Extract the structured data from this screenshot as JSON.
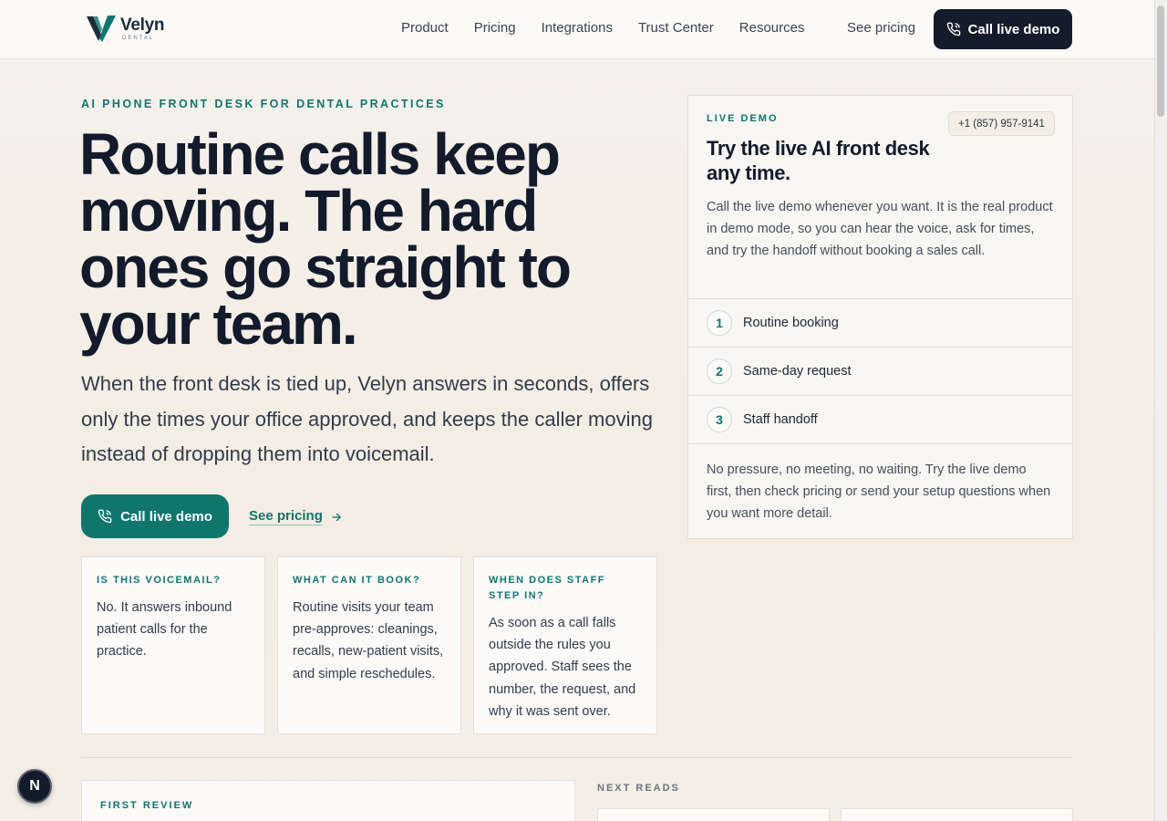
{
  "brand": {
    "name": "Velyn",
    "sub": "DENTAL"
  },
  "nav": {
    "items": [
      "Product",
      "Pricing",
      "Integrations",
      "Trust Center",
      "Resources"
    ],
    "see_pricing": "See pricing",
    "cta": "Call live demo"
  },
  "hero": {
    "eyebrow": "AI PHONE FRONT DESK FOR DENTAL PRACTICES",
    "title": "Routine calls keep moving. The hard ones go straight to your team.",
    "subtitle": "When the front desk is tied up, Velyn answers in seconds, offers only the times your office approved, and keeps the caller moving instead of dropping them into voicemail.",
    "cta_primary": "Call live demo",
    "cta_secondary": "See pricing"
  },
  "faq": [
    {
      "q": "IS THIS VOICEMAIL?",
      "a": "No. It answers inbound patient calls for the practice."
    },
    {
      "q": "WHAT CAN IT BOOK?",
      "a": "Routine visits your team pre-approves: cleanings, recalls, new-patient visits, and simple reschedules."
    },
    {
      "q": "WHEN DOES STAFF STEP IN?",
      "a": "As soon as a call falls outside the rules you approved. Staff sees the number, the request, and why it was sent over."
    }
  ],
  "demo": {
    "eyebrow": "LIVE DEMO",
    "phone": "+1 (857) 957-9141",
    "title": "Try the live AI front desk any time.",
    "body": "Call the live demo whenever you want. It is the real product in demo mode, so you can hear the voice, ask for times, and try the handoff without booking a sales call.",
    "steps": [
      {
        "num": "1",
        "label": "Routine booking"
      },
      {
        "num": "2",
        "label": "Same-day request"
      },
      {
        "num": "3",
        "label": "Staff handoff"
      }
    ],
    "footer": "No pressure, no meeting, no waiting. Try the live demo first, then check pricing or send your setup questions when you want more detail."
  },
  "lower": {
    "first_review": "FIRST REVIEW",
    "next_reads": "NEXT READS"
  },
  "badge": {
    "letter": "N"
  },
  "colors": {
    "accent": "#0f766e",
    "dark": "#141b2b"
  }
}
